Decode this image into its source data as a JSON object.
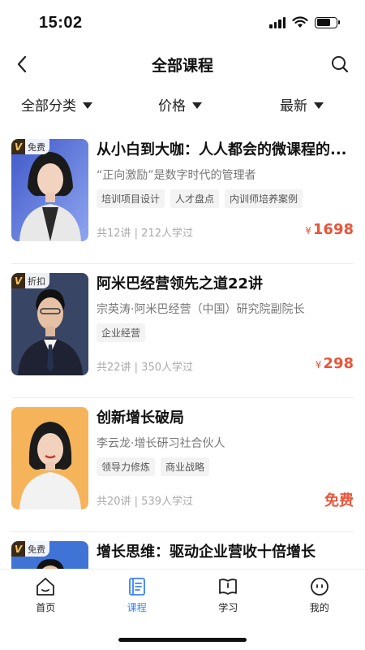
{
  "status_bar": {
    "time": "15:02"
  },
  "nav": {
    "title": "全部课程"
  },
  "filters": [
    {
      "label": "全部分类"
    },
    {
      "label": "价格"
    },
    {
      "label": "最新"
    }
  ],
  "courses": [
    {
      "badge": "免费",
      "title": "从小白到大咖：人人都会的微课程的...",
      "subtitle": "“正向激励”是数字时代的管理者",
      "tags": [
        "培训项目设计",
        "人才盘点",
        "内训师培养案例"
      ],
      "meta": "共12讲 | 212人学过",
      "price_symbol": "¥",
      "price": "1698"
    },
    {
      "badge": "折扣",
      "title": "阿米巴经营领先之道22讲",
      "subtitle": "宗英涛·阿米巴经营（中国）研究院副院长",
      "tags": [
        "企业经营"
      ],
      "meta": "共22讲 | 350人学过",
      "price_symbol": "¥",
      "price": "298"
    },
    {
      "badge": "",
      "title": "创新增长破局",
      "subtitle": "李云龙·增长研习社合伙人",
      "tags": [
        "领导力修炼",
        "商业战略"
      ],
      "meta": "共20讲 | 539人学过",
      "price_symbol": "",
      "price": "免费"
    },
    {
      "badge": "免费",
      "title": "增长思维：驱动企业营收十倍增长",
      "subtitle": "",
      "tags": [],
      "meta": "",
      "price_symbol": "",
      "price": ""
    }
  ],
  "tabbar": [
    {
      "label": "首页",
      "icon": "home-icon"
    },
    {
      "label": "课程",
      "icon": "course-icon",
      "active": true
    },
    {
      "label": "学习",
      "icon": "learn-icon"
    },
    {
      "label": "我的",
      "icon": "profile-icon"
    }
  ],
  "colors": {
    "accent": "#3b82f6",
    "price": "#e9553a",
    "badge_v": "#f2c15a"
  }
}
